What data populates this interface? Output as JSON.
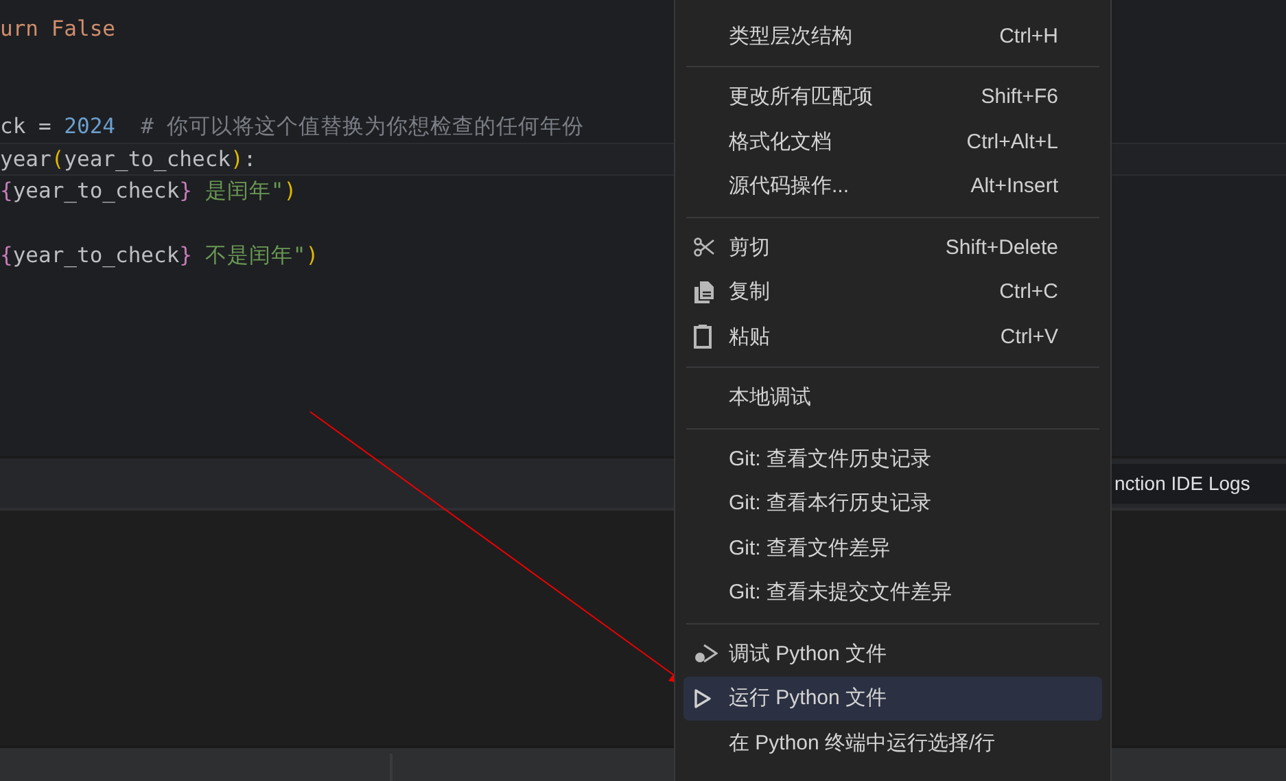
{
  "editor": {
    "lines": [
      {
        "current": false,
        "tokens": [
          {
            "text": "urn False",
            "kind": "keyword"
          }
        ]
      },
      {
        "current": false
      },
      {
        "current": false
      },
      {
        "current": false,
        "tokens": [
          {
            "text": "ck = ",
            "kind": "plain"
          },
          {
            "text": "2024",
            "kind": "number"
          },
          {
            "text": "  # 你可以将这个值替换为你想检查的任何年份",
            "kind": "comment"
          }
        ]
      },
      {
        "current": true,
        "tokens": [
          {
            "text": "year",
            "kind": "plain"
          },
          {
            "text": "(",
            "kind": "paren"
          },
          {
            "text": "year_to_check",
            "kind": "plain"
          },
          {
            "text": ")",
            "kind": "paren"
          },
          {
            "text": ":",
            "kind": "plain"
          }
        ]
      },
      {
        "current": false,
        "tokens": [
          {
            "text": "{",
            "kind": "brace"
          },
          {
            "text": "year_to_check",
            "kind": "plain"
          },
          {
            "text": "}",
            "kind": "brace"
          },
          {
            "text": " 是闰年\"",
            "kind": "string"
          },
          {
            "text": ")",
            "kind": "paren"
          }
        ]
      },
      {
        "current": false
      },
      {
        "current": false,
        "tokens": [
          {
            "text": "{",
            "kind": "brace"
          },
          {
            "text": "year_to_check",
            "kind": "plain"
          },
          {
            "text": "}",
            "kind": "brace"
          },
          {
            "text": " 不是闰年\"",
            "kind": "string"
          },
          {
            "text": ")",
            "kind": "paren"
          }
        ]
      }
    ]
  },
  "panel": {
    "tabs": [
      {
        "label": "nction IDE Logs",
        "selected": true
      }
    ]
  },
  "context_menu": {
    "items": [
      {
        "kind": "item",
        "label": "类型层次结构",
        "shortcut": "Ctrl+H",
        "selected": false
      },
      {
        "kind": "separator"
      },
      {
        "kind": "item",
        "label": "更改所有匹配项",
        "shortcut": "Shift+F6",
        "selected": false
      },
      {
        "kind": "item",
        "label": "格式化文档",
        "shortcut": "Ctrl+Alt+L",
        "selected": false
      },
      {
        "kind": "item",
        "label": "源代码操作...",
        "shortcut": "Alt+Insert",
        "selected": false
      },
      {
        "kind": "separator"
      },
      {
        "kind": "cut",
        "label": "剪切",
        "shortcut": "Shift+Delete",
        "selected": false
      },
      {
        "kind": "copy",
        "label": "复制",
        "shortcut": "Ctrl+C",
        "selected": false
      },
      {
        "kind": "paste",
        "label": "粘贴",
        "shortcut": "Ctrl+V",
        "selected": false
      },
      {
        "kind": "separator"
      },
      {
        "kind": "item",
        "label": "本地调试",
        "selected": false
      },
      {
        "kind": "separator"
      },
      {
        "kind": "item",
        "label": "Git: 查看文件历史记录",
        "selected": false
      },
      {
        "kind": "item",
        "label": "Git: 查看本行历史记录",
        "selected": false
      },
      {
        "kind": "item",
        "label": "Git: 查看文件差异",
        "selected": false
      },
      {
        "kind": "item",
        "label": "Git: 查看未提交文件差异",
        "selected": false
      },
      {
        "kind": "separator"
      },
      {
        "kind": "debug",
        "label": "调试 Python 文件",
        "selected": false
      },
      {
        "kind": "run",
        "label": "运行 Python 文件",
        "selected": true
      },
      {
        "kind": "item",
        "label": "在 Python 终端中运行选择/行",
        "selected": false
      }
    ]
  }
}
